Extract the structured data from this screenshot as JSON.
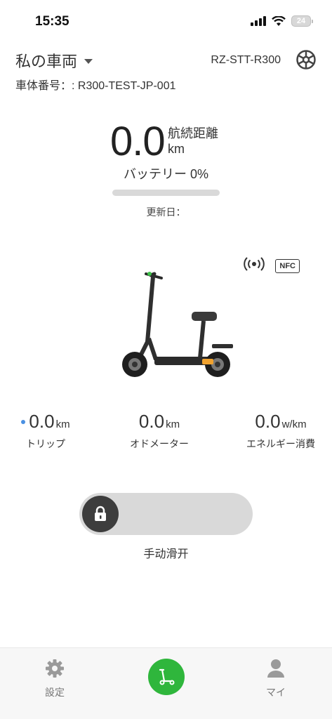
{
  "status_bar": {
    "time": "15:35",
    "battery_level": "24",
    "icons": [
      "cellular-signal-icon",
      "wifi-icon",
      "battery-icon"
    ]
  },
  "header": {
    "vehicle_name": "私の車両",
    "model_code": "RZ-STT-R300",
    "vehicle_number": "車体番号：: R300-TEST-JP-001",
    "settings_icon": "steering-wheel-icon"
  },
  "range": {
    "value": "0.0",
    "label": "航続距離",
    "unit": "km",
    "battery_text": "バッテリー 0%",
    "battery_percent": 0,
    "updated": "更新日："
  },
  "connectivity": {
    "signal_icon": "wireless-signal-icon",
    "nfc_label": "NFC"
  },
  "stats": [
    {
      "value": "0.0",
      "unit": "km",
      "label": "トリップ",
      "active": true
    },
    {
      "value": "0.0",
      "unit": "km",
      "label": "オドメーター",
      "active": false
    },
    {
      "value": "0.0",
      "unit": "w/km",
      "label": "エネルギー消費",
      "active": false
    }
  ],
  "unlock": {
    "caption": "手动滑开",
    "knob_icon": "lock-icon",
    "slide_progress": 0
  },
  "tab_bar": {
    "settings_label": "設定",
    "center_icon": "scooter-icon",
    "me_label": "マイ"
  },
  "colors": {
    "accent_blue": "#4a90e2",
    "accent_green": "#2fb63c",
    "knob": "#3d3d3d",
    "track": "#d9d9d9"
  }
}
